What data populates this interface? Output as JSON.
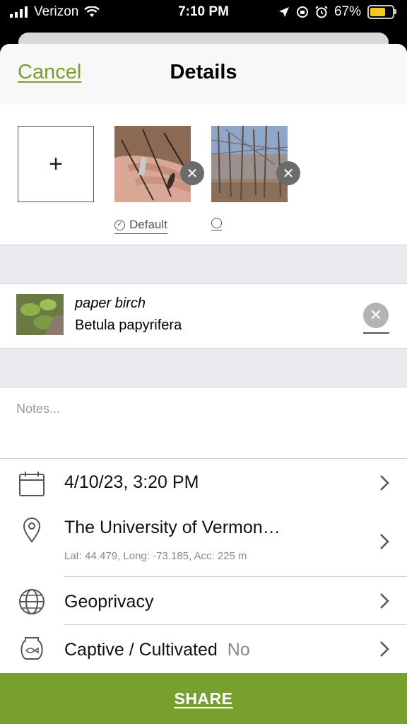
{
  "status_bar": {
    "carrier": "Verizon",
    "time": "7:10 PM",
    "battery_percent": "67%",
    "battery_level": 0.67,
    "icons": [
      "signal-icon",
      "wifi-icon",
      "location-arrow-icon",
      "orientation-lock-icon",
      "alarm-icon",
      "battery-icon"
    ]
  },
  "nav": {
    "cancel_label": "Cancel",
    "title": "Details"
  },
  "photos": {
    "add_icon": "+",
    "items": [
      {
        "subject": "birch twig in hand",
        "default_label": "Default",
        "is_default": true
      },
      {
        "subject": "bare forest trees",
        "default_label": "",
        "is_default": false
      }
    ]
  },
  "taxon": {
    "common_name": "paper birch",
    "scientific_name": "Betula papyrifera"
  },
  "notes": {
    "placeholder": "Notes..."
  },
  "details": {
    "date_time": "4/10/23, 3:20 PM",
    "location_name": "The University of Vermon…",
    "location_coords": "Lat: 44.479, Long: -73.185, Acc: 225 m",
    "geoprivacy_label": "Geoprivacy",
    "captive_label": "Captive / Cultivated",
    "captive_value": "No"
  },
  "share_label": "SHARE",
  "colors": {
    "accent": "#77a02e",
    "battery": "#f7c525",
    "section_gap": "#ebebef"
  }
}
